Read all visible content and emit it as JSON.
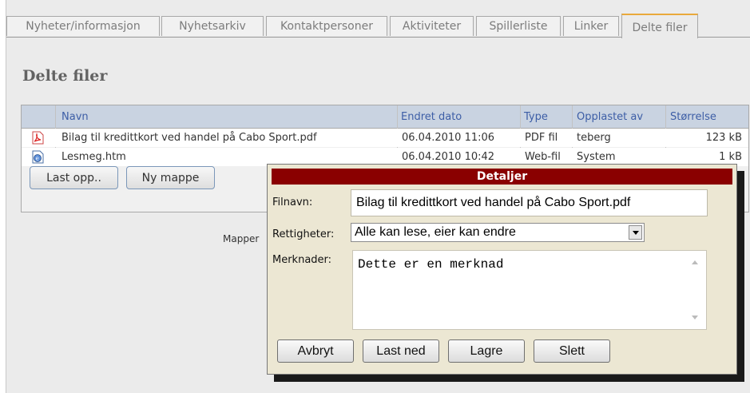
{
  "tabs": [
    {
      "label": "Nyheter/informasjon"
    },
    {
      "label": "Nyhetsarkiv"
    },
    {
      "label": "Kontaktpersoner"
    },
    {
      "label": "Aktiviteter"
    },
    {
      "label": "Spillerliste"
    },
    {
      "label": "Linker"
    },
    {
      "label": "Delte filer",
      "active": true
    }
  ],
  "page": {
    "heading": "Delte filer"
  },
  "table": {
    "headers": {
      "name": "Navn",
      "date": "Endret dato",
      "type": "Type",
      "uploader": "Opplastet av",
      "size": "Størrelse"
    },
    "rows": [
      {
        "icon": "pdf-file-icon",
        "name": "Bilag til kredittkort ved handel på Cabo Sport.pdf",
        "date": "06.04.2010 11:06",
        "type": "PDF fil",
        "uploader": "teberg",
        "size": "123 kB"
      },
      {
        "icon": "web-file-icon",
        "name": "Lesmeg.htm",
        "date": "06.04.2010 10:42",
        "type": "Web-fil",
        "uploader": "System",
        "size": "1 kB"
      }
    ]
  },
  "toolbar": {
    "upload_label": "Last opp..",
    "new_folder_label": "Ny mappe",
    "folder_label": "Mapper"
  },
  "dialog": {
    "title": "Detaljer",
    "filename_label": "Filnavn:",
    "filename_value": "Bilag til kredittkort ved handel på Cabo Sport.pdf",
    "rights_label": "Rettigheter:",
    "rights_value": "Alle kan lese, eier kan endre",
    "notes_label": "Merknader:",
    "notes_value": "Dette er en merknad",
    "buttons": {
      "cancel": "Avbryt",
      "download": "Last ned",
      "save": "Lagre",
      "delete": "Slett"
    }
  },
  "colors": {
    "title_bar": "#8a0000",
    "header_bg": "#c9d3e1",
    "header_text": "#3d5ea6",
    "active_tab_accent": "#e9a93b",
    "dialog_bg": "#ece7d3"
  }
}
